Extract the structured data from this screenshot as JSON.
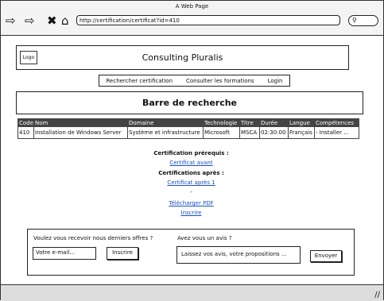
{
  "window": {
    "title": "A Web Page",
    "url": "http://certification/certificat?id=410"
  },
  "header": {
    "logo": "Logo",
    "site_title": "Consulting Pluralis"
  },
  "menu": {
    "items": [
      "Rechercher certification",
      "Consulter les formations",
      "Login"
    ]
  },
  "search": {
    "title": "Barre de recherche"
  },
  "table": {
    "columns": [
      "Code",
      "Nom",
      "Domaine",
      "Technologie",
      "Titre",
      "Durée",
      "Langue",
      "Compétences"
    ],
    "rows": [
      [
        "410",
        "Installation de Windows Server",
        "Système et infrastructure",
        "Microsoft",
        "MSCA",
        "02:30:00",
        "Français",
        "- Installer ..."
      ]
    ]
  },
  "details": {
    "prereq_label": "Certification prérequis :",
    "prereq_link": "Certificat avant",
    "after_label": "Certifications après :",
    "after_link": "Certificat après 1",
    "bullet": "-",
    "pdf_link": "Télécharger PDF",
    "register_link": "Inscrire"
  },
  "footer": {
    "newsletter_question": "Voulez vous recevoir nous derniers offres ?",
    "email_placeholder": "Votre e-mail...",
    "subscribe_label": "Inscrire",
    "opinion_question": "Avez vous un avis ?",
    "opinion_placeholder": "Laissez vos avis, votre propositions ...",
    "send_label": "Envoyer"
  }
}
